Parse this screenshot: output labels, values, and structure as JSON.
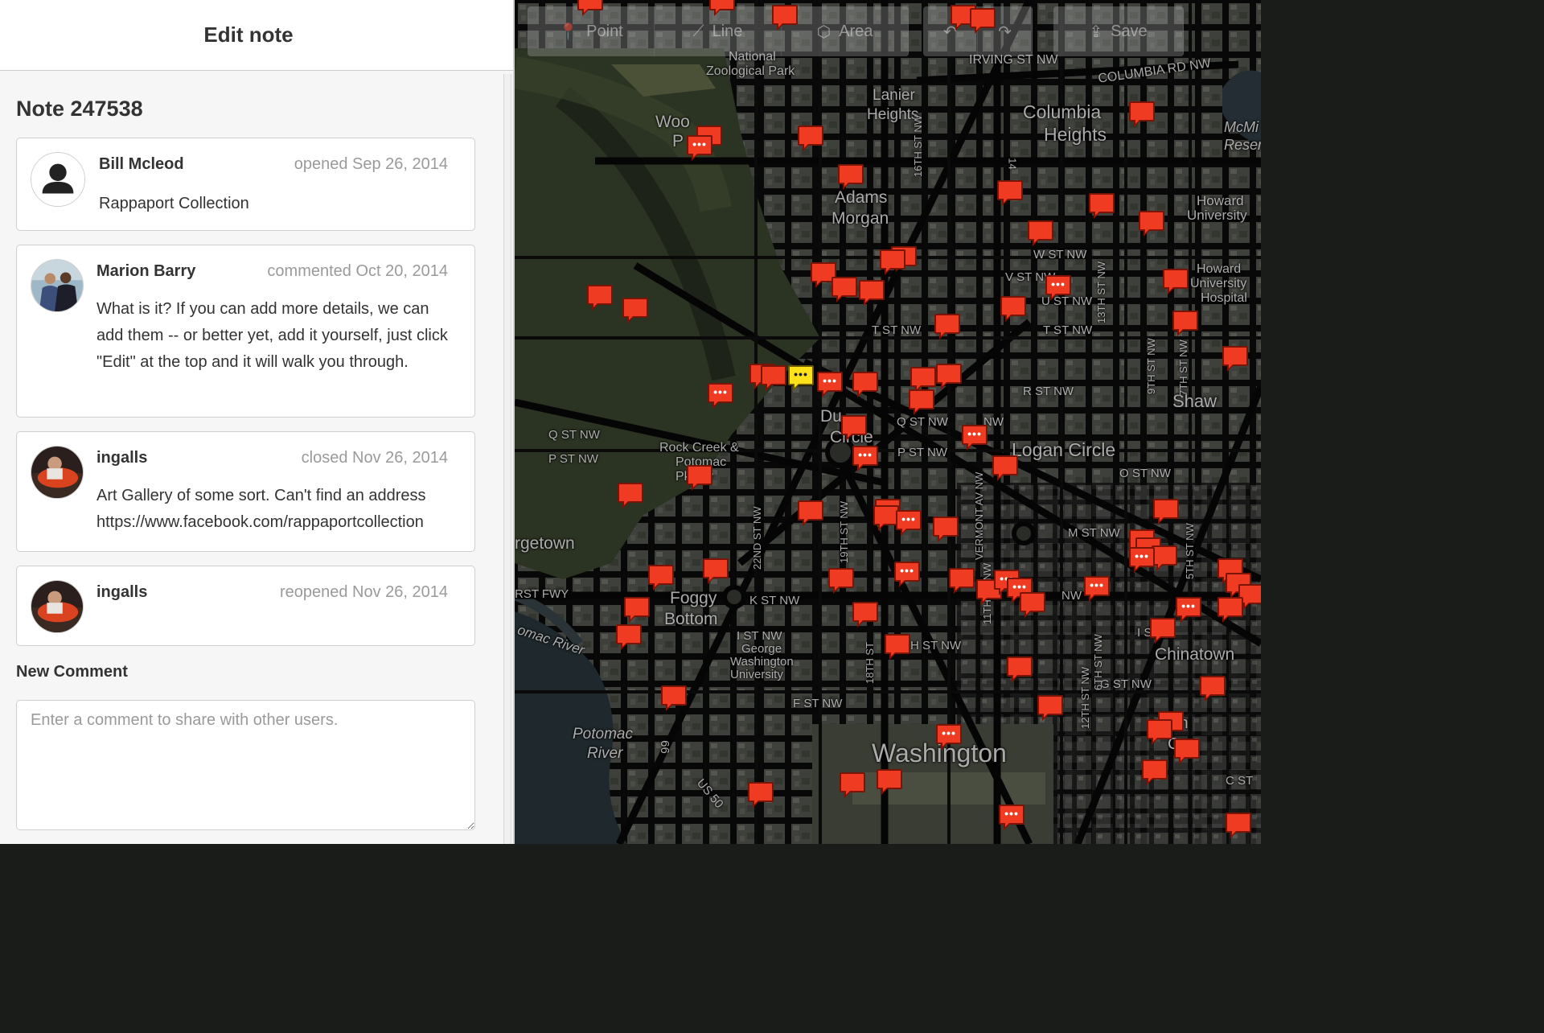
{
  "sidebar": {
    "header_title": "Edit note",
    "note_title": "Note 247538",
    "comments": [
      {
        "author": "Bill Mcleod",
        "action": "opened Sep 26, 2014",
        "text": "Rappaport Collection"
      },
      {
        "author": "Marion Barry",
        "action": "commented Oct 20, 2014",
        "text": "What is it? If you can add more details, we can add them -- or better yet, add it yourself, just click \"Edit\" at the top and it will walk you through."
      },
      {
        "author": "ingalls",
        "action": "closed Nov 26, 2014",
        "text": "Art Gallery of some sort. Can't find an address https://www.facebook.com/rappaportcollection"
      },
      {
        "author": "ingalls",
        "action": "reopened Nov 26, 2014",
        "text": ""
      }
    ],
    "new_comment_label": "New Comment",
    "new_comment_placeholder": "Enter a comment to share with other users."
  },
  "toolbar": {
    "point_label": "Point",
    "line_label": "Line",
    "area_label": "Area",
    "save_label": "Save"
  },
  "map_labels": {
    "national_zoo_1": "National",
    "national_zoo_2": "Zoological Park",
    "irving": "IRVING ST NW",
    "columbia_rd": "COLUMBIA RD NW",
    "lanier_1": "Lanier",
    "lanier_2": "Heights",
    "columbia_1": "Columbia",
    "columbia_2": "Heights",
    "mcmillan_1": "McMi",
    "mcmillan_2": "Reser",
    "wood_1": "Woo",
    "wood_2": "P",
    "adams_1": "Adams",
    "adams_2": "Morgan",
    "howard_u_1": "Howard",
    "howard_u_2": "University",
    "w_st": "W ST NW",
    "v_st": "V ST NW",
    "u_st": "U ST NW",
    "t_st": "T ST NW",
    "t_st2": "T ST NW",
    "howard_h_1": "Howard",
    "howard_h_2": "University",
    "howard_h_3": "Hospital",
    "r_st": "R ST NW",
    "shaw": "Shaw",
    "q_st": "Q ST NW",
    "q_st_left": "Q ST NW",
    "p_st_left": "P ST NW",
    "p_st": "P ST NW",
    "nw_small": "NW",
    "dupont_1": "Du",
    "dupont_2": "Circle",
    "rock_creek_1": "Rock Creek &",
    "rock_creek_2": "Potomac",
    "rock_creek_3": "Pkway",
    "logan": "Logan Circle",
    "o_st": "O ST NW",
    "georgetown": "rgetown",
    "m_st": "M ST NW",
    "rst_fwy": "RST FWY",
    "foggy_1": "Foggy",
    "foggy_2": "Bottom",
    "k_st": "K ST NW",
    "nw2": "NW",
    "potomac_river": "omac River",
    "i_st": "I ST NW",
    "i_st2": "I ST",
    "gwu_1": "George",
    "gwu_2": "Washington",
    "gwu_3": "University",
    "h_st": "H ST NW",
    "chinatown": "Chinatown",
    "g_st": "G ST NW",
    "f_st": "F ST NW",
    "potomac_1": "Potomac",
    "potomac_2": "River",
    "washington": "Washington",
    "in_suffix": "in",
    "cu_suffix": "Cu",
    "c_st": "C ST",
    "i66": "66",
    "us50": "US 50",
    "st16": "16TH ST NW",
    "st14": "14",
    "st22": "22ND ST NW",
    "st19": "19TH ST NW",
    "st18": "18TH ST",
    "st11": "11TH ST NW",
    "st9": "9TH ST NW",
    "st7": "7TH ST NW",
    "st12": "12TH ST NW",
    "st13": "13TH ST NW",
    "vermont": "VERMONT AV NW",
    "st5": "5TH ST NW",
    "st6": "6TH ST NW"
  }
}
